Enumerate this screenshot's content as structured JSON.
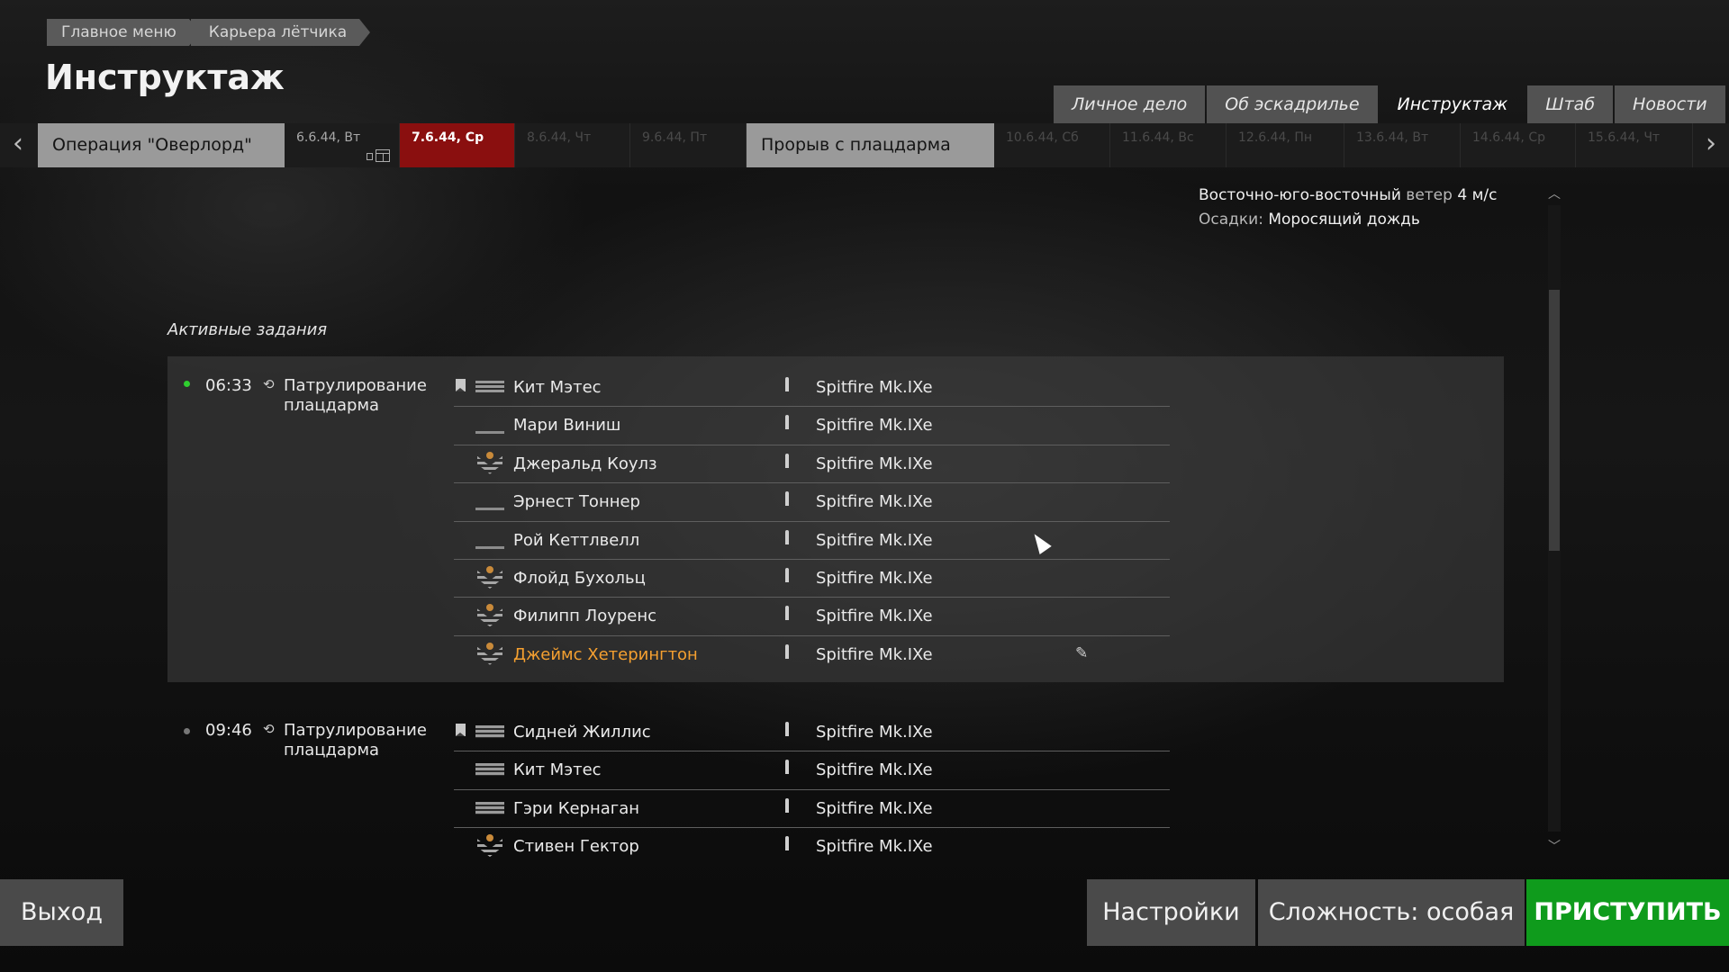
{
  "breadcrumb": [
    "Главное меню",
    "Карьера лётчика"
  ],
  "title": "Инструктаж",
  "tabs": [
    "Личное дело",
    "Об эскадрилье",
    "Инструктаж",
    "Штаб",
    "Новости"
  ],
  "active_tab": "Инструктаж",
  "operations": {
    "first": "Операция \"Оверлорд\"",
    "second": "Прорыв с плацдарма"
  },
  "dates": {
    "d1": "6.6.44, Вт",
    "d2": "7.6.44, Ср",
    "d3": "8.6.44, Чт",
    "d4": "9.6.44, Пт",
    "d5": "10.6.44, Сб",
    "d6": "11.6.44, Вс",
    "d7": "12.6.44, Пн",
    "d8": "13.6.44, Вт",
    "d9": "14.6.44, Ср",
    "d10": "15.6.44, Чт"
  },
  "weather": {
    "wind_dir": "Восточно-юго-восточный",
    "wind_label": "ветер",
    "wind_speed": "4 м/с",
    "precip_label": "Осадки:",
    "precip_value": "Моросящий дождь"
  },
  "section_label": "Активные задания",
  "missions": [
    {
      "time": "06:33",
      "name": "Патрулирование плацдарма",
      "pilots": [
        {
          "name": "Кит Мэтес",
          "plane": "Spitfire Mk.IXe",
          "rank": "bars"
        },
        {
          "name": "Мари Виниш",
          "plane": "Spitfire Mk.IXe",
          "rank": "bar1"
        },
        {
          "name": "Джеральд Коулз",
          "plane": "Spitfire Mk.IXe",
          "rank": "chevron"
        },
        {
          "name": "Эрнест Тоннер",
          "plane": "Spitfire Mk.IXe",
          "rank": "bar1"
        },
        {
          "name": "Рой Кеттлвелл",
          "plane": "Spitfire Mk.IXe",
          "rank": "bar1"
        },
        {
          "name": "Флойд Бухольц",
          "plane": "Spitfire Mk.IXe",
          "rank": "chevron"
        },
        {
          "name": "Филипп Лоуренс",
          "plane": "Spitfire Mk.IXe",
          "rank": "chevron"
        },
        {
          "name": "Джеймс Хетерингтон",
          "plane": "Spitfire Mk.IXe",
          "rank": "chevron",
          "is_player": true
        }
      ]
    },
    {
      "time": "09:46",
      "name": "Патрулирование плацдарма",
      "pilots": [
        {
          "name": "Сидней Жиллис",
          "plane": "Spitfire Mk.IXe",
          "rank": "bars"
        },
        {
          "name": "Кит Мэтес",
          "plane": "Spitfire Mk.IXe",
          "rank": "bars"
        },
        {
          "name": "Гэри Кернаган",
          "plane": "Spitfire Mk.IXe",
          "rank": "bars"
        },
        {
          "name": "Стивен Гектор",
          "plane": "Spitfire Mk.IXe",
          "rank": "chevron"
        }
      ]
    }
  ],
  "buttons": {
    "exit": "Выход",
    "settings": "Настройки",
    "difficulty": "Сложность: особая",
    "start": "ПРИСТУПИТЬ"
  },
  "colors": {
    "current_day": "#8a0f0f",
    "start_button": "#0f9b1c",
    "player_name": "#f5a030",
    "active_dot": "#2fcf2f"
  },
  "icons": {
    "left": "chevron-left-icon",
    "right": "chevron-right-icon",
    "calendar": "calendar-icon",
    "patrol": "patrol-mission-icon",
    "leader": "flight-leader-flag-icon",
    "loadout": "bomb-loadout-icon",
    "wrench": "wrench-icon"
  }
}
